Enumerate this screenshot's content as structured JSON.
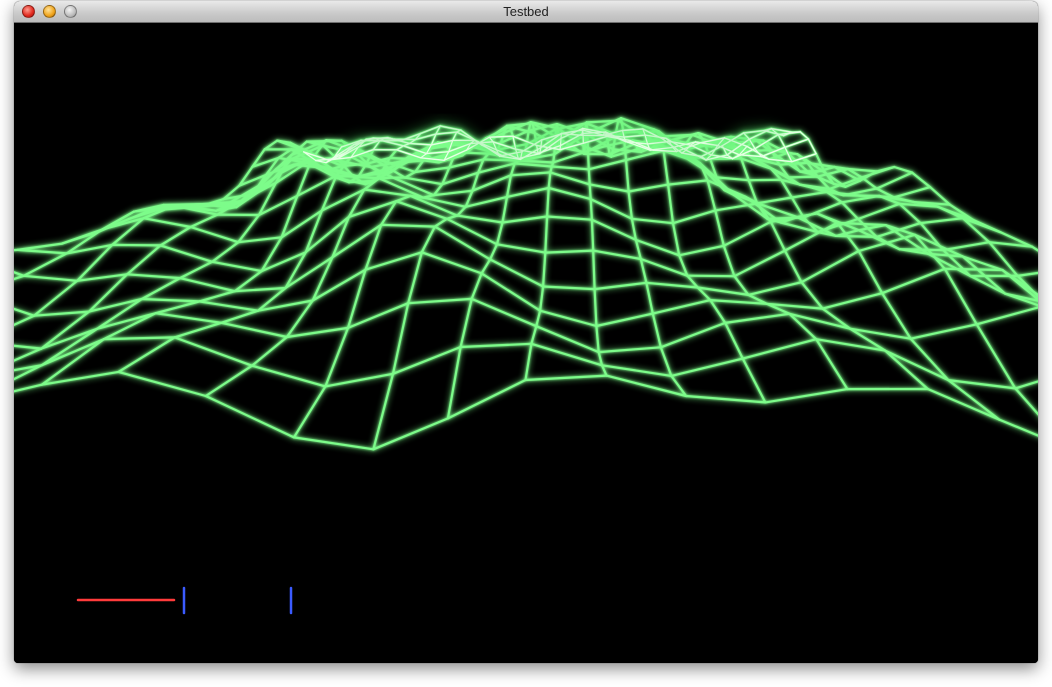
{
  "window": {
    "title": "Testbed"
  },
  "controls": {
    "close_icon": "close-icon",
    "minimize_icon": "minimize-icon",
    "zoom_icon": "zoom-icon"
  },
  "scene": {
    "grid_color": "#7dfc8a",
    "glow_color": "#3fd95a",
    "highlight_color": "#e8ffe6",
    "axis_x_color": "#ff3b3b",
    "axis_blue_color": "#3b5bff",
    "background": "#000000"
  }
}
